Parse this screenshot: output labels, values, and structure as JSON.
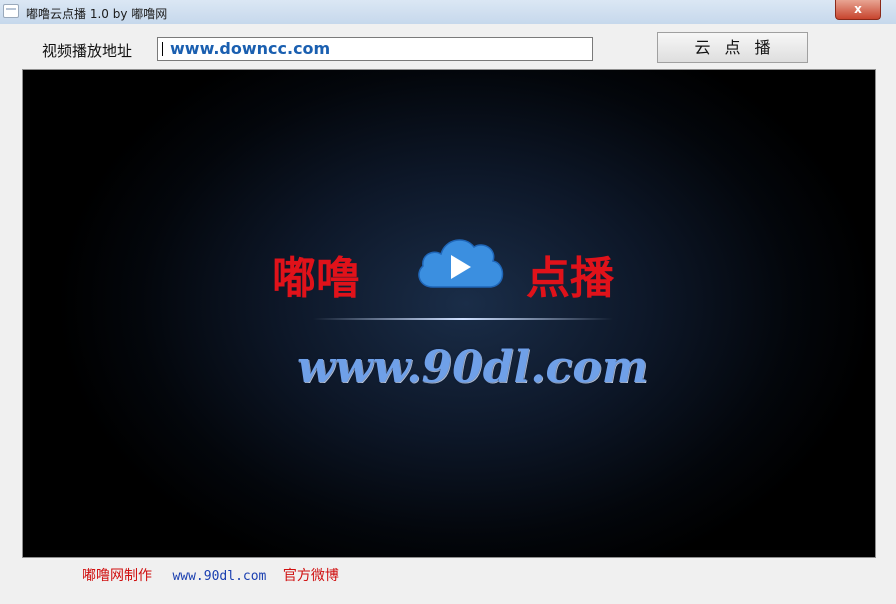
{
  "window": {
    "title": "嘟噜云点播 1.0  by 嘟噜网",
    "close_label": "x"
  },
  "toolbar": {
    "url_label": "视频播放地址",
    "url_value": "www.downcc.com",
    "play_button_label": "云点播"
  },
  "video": {
    "logo_left": "嘟噜",
    "logo_right": "点播",
    "site_url": "www.90dl.com",
    "icon": "cloud-play-icon"
  },
  "footer": {
    "made_by": "嘟噜网制作",
    "link": "www.90dl.com",
    "weibo": "官方微博"
  },
  "colors": {
    "accent_red": "#e0121a",
    "link_blue": "#1a3fb0",
    "url_blue": "#6fa0e8"
  }
}
